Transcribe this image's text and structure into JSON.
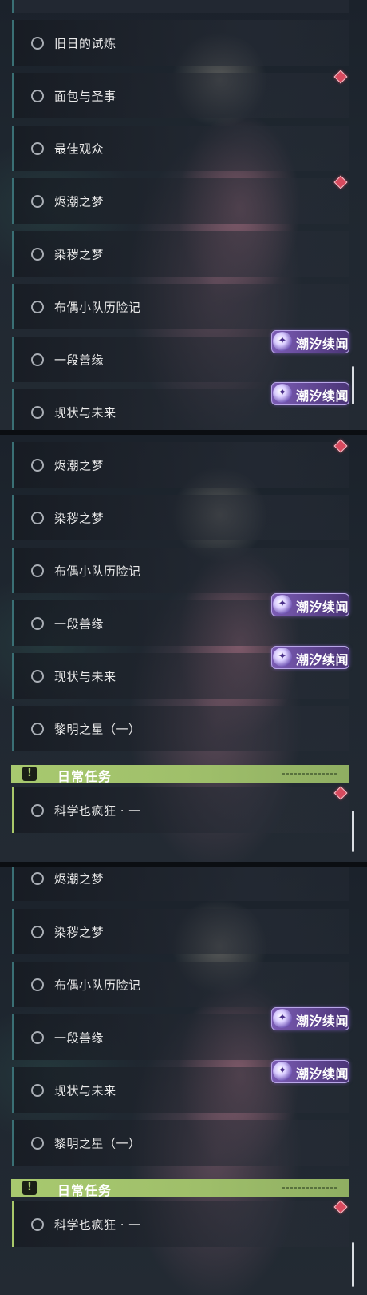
{
  "panel1": {
    "quests": [
      {
        "label": "旧日的试炼"
      },
      {
        "label": "面包与圣事"
      },
      {
        "label": "最佳观众"
      },
      {
        "label": "烬潮之梦"
      },
      {
        "label": "染秽之梦"
      },
      {
        "label": "布偶小队历险记"
      },
      {
        "label": "一段善缘"
      },
      {
        "label": "现状与未来"
      }
    ],
    "tags": [
      {
        "text": "潮汐续闻"
      },
      {
        "text": "潮汐续闻"
      }
    ]
  },
  "panel2": {
    "quests": [
      {
        "label": "烬潮之梦"
      },
      {
        "label": "染秽之梦"
      },
      {
        "label": "布偶小队历险记"
      },
      {
        "label": "一段善缘"
      },
      {
        "label": "现状与未来"
      },
      {
        "label": "黎明之星（一）"
      }
    ],
    "tags": [
      {
        "text": "潮汐续闻"
      },
      {
        "text": "潮汐续闻"
      }
    ],
    "daily_header": "日常任务",
    "daily_quests": [
      {
        "label": "科学也疯狂 · 一"
      }
    ]
  },
  "panel3": {
    "quests": [
      {
        "label": "烬潮之梦"
      },
      {
        "label": "染秽之梦"
      },
      {
        "label": "布偶小队历险记"
      },
      {
        "label": "一段善缘"
      },
      {
        "label": "现状与未来"
      },
      {
        "label": "黎明之星（一）"
      }
    ],
    "tags": [
      {
        "text": "潮汐续闻"
      },
      {
        "text": "潮汐续闻"
      }
    ],
    "daily_header": "日常任务",
    "daily_quests": [
      {
        "label": "科学也疯狂 · 一"
      }
    ]
  },
  "icons": {
    "status": "circle-outline-icon",
    "marker": "red-diamond-icon",
    "tag_emblem": "star-sparkle-icon",
    "header_icon": "exclamation-icon"
  },
  "colors": {
    "marker": "#d84a5e",
    "daily_header": "#a8c96f",
    "tag": "#6b4fb0",
    "accent_bar": "#3a6f74"
  }
}
